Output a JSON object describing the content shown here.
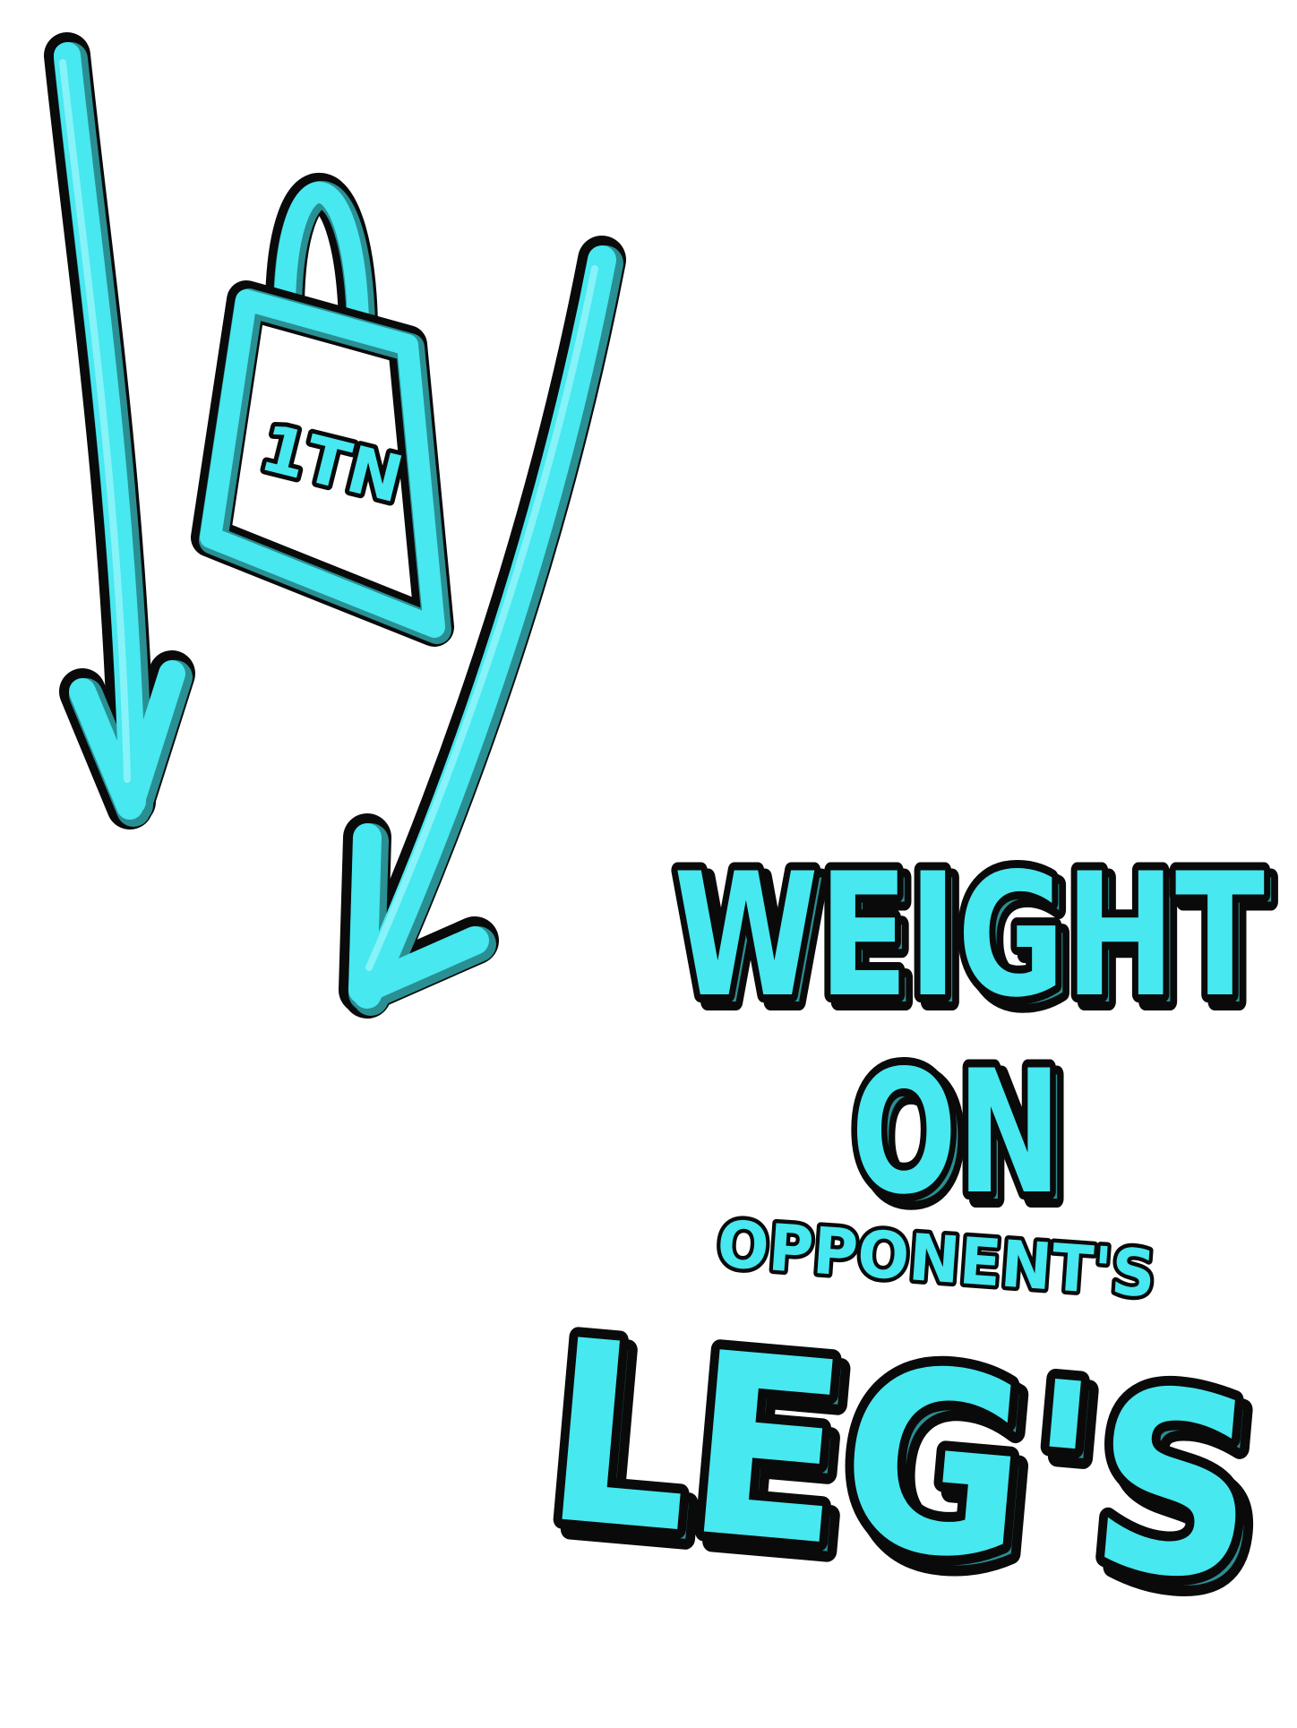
{
  "caption": {
    "line1": "WEIGHT",
    "line2": "ON",
    "line3": "OPPONENT'S",
    "line4": "LEG'S"
  },
  "weight_label": "1TN",
  "colors": {
    "background": "#ffffff",
    "neon_fill": "#47e8f0",
    "neon_shadow": "#2a8f93",
    "outline": "#0a0a0a"
  },
  "icons": {
    "left_arrow": "arrow-down-icon",
    "right_arrow": "arrow-down-left-icon",
    "weight": "weight-bag-icon"
  }
}
